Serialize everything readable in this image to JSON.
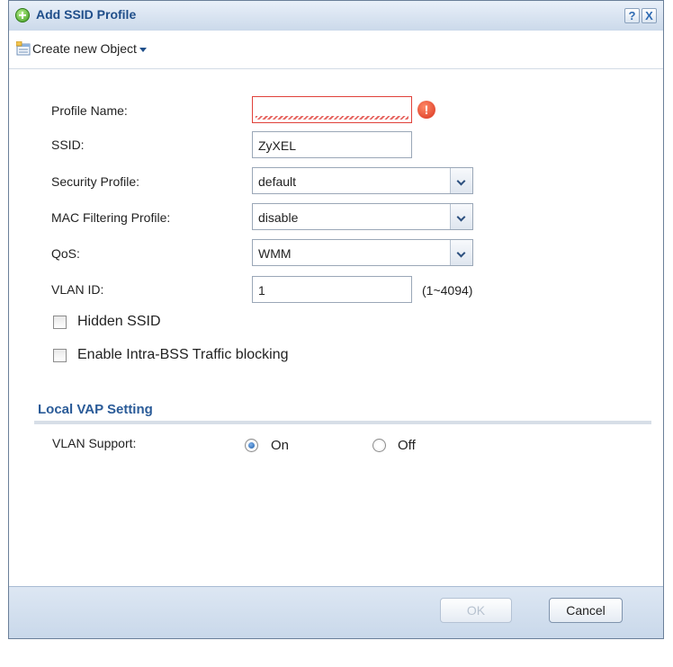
{
  "dialog": {
    "title": "Add SSID Profile",
    "help_label": "?",
    "close_label": "X"
  },
  "toolbar": {
    "create_label": "Create new Object"
  },
  "form": {
    "profile_name": {
      "label": "Profile Name:",
      "value": "",
      "error_icon": "!"
    },
    "ssid": {
      "label": "SSID:",
      "value": "ZyXEL"
    },
    "security_profile": {
      "label": "Security Profile:",
      "value": "default"
    },
    "mac_filtering": {
      "label": "MAC Filtering Profile:",
      "value": "disable"
    },
    "qos": {
      "label": "QoS:",
      "value": "WMM"
    },
    "vlan_id": {
      "label": "VLAN ID:",
      "value": "1",
      "range": "(1~4094)"
    },
    "hidden_ssid": {
      "label": "Hidden SSID",
      "checked": false
    },
    "intra_bss": {
      "label": "Enable Intra-BSS Traffic blocking",
      "checked": false
    }
  },
  "local_vap": {
    "title": "Local VAP Setting",
    "vlan_support": {
      "label": "VLAN Support:",
      "on_label": "On",
      "off_label": "Off",
      "selected": "On"
    }
  },
  "footer": {
    "ok_label": "OK",
    "cancel_label": "Cancel"
  },
  "colors": {
    "title_text": "#1f4e8a",
    "section_title": "#2a5b98",
    "error": "#e0413a"
  }
}
